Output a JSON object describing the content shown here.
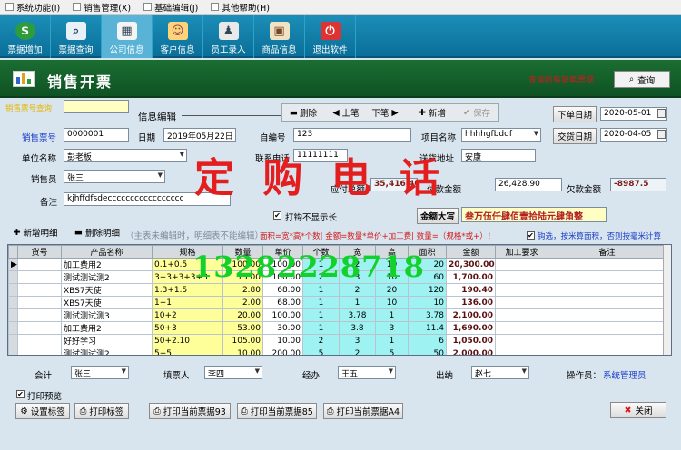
{
  "menubar": [
    "系统功能(I)",
    "销售管理(X)",
    "基础编辑(J)",
    "其他帮助(H)"
  ],
  "toolbar": [
    {
      "label": "票据增加",
      "icon": "dollar-icon"
    },
    {
      "label": "票据查询",
      "icon": "magnifier-icon"
    },
    {
      "label": "公司信息",
      "icon": "building-icon"
    },
    {
      "label": "客户信息",
      "icon": "customer-icon"
    },
    {
      "label": "员工录入",
      "icon": "employee-icon"
    },
    {
      "label": "商品信息",
      "icon": "product-icon"
    },
    {
      "label": "退出软件",
      "icon": "exit-icon"
    }
  ],
  "header": {
    "title": "销售开票",
    "hint": "查询所有销售票据",
    "query": "查询"
  },
  "form": {
    "search_label": "销售票号查询",
    "section": "信息编辑",
    "btn_delete": "删除",
    "btn_prev": "上笔",
    "btn_next": "下笔",
    "btn_new": "新增",
    "btn_save": "保存",
    "order_date_label": "下单日期",
    "order_date": "2020-05-01",
    "delivery_date_label": "交货日期",
    "delivery_date": "2020-04-05",
    "ticket_no_label": "销售票号",
    "ticket_no": "0000001",
    "date_label": "日期",
    "date": "2019年05月22日",
    "self_no_label": "自编号",
    "self_no": "123",
    "project_label": "项目名称",
    "project": "hhhhgfbddf",
    "unit_label": "单位名称",
    "unit": "彭老板",
    "phone_label": "联系电话",
    "phone": "11111111",
    "address_label": "送货地址",
    "address": "安康",
    "seller_label": "销售员",
    "seller": "张三",
    "receivable_label": "应付总额",
    "receivable": "35,416.40",
    "paid_label": "付款金额",
    "paid": "26,428.90",
    "owed_label": "欠款金额",
    "owed": "-8987.5",
    "remark_label": "备注",
    "remark": "kjhffdfsdeccccccccccccccccc",
    "hide_label": "打钩不显示长",
    "amount_upper_label": "金额大写",
    "amount_upper": "叁万伍仟肆佰壹拾陆元肆角整"
  },
  "detail": {
    "add": "新增明细",
    "del": "删除明细",
    "note": "（主表未编辑时，明细表不能编辑）",
    "formula": "面积=宽*高*个数|  金额=数量*单价+加工费|  数量=（规格*或+）！",
    "hint": "钩选，按米算面积，否则按毫米计算"
  },
  "watermark": {
    "text": "定 购 电 话",
    "number": "13282228718"
  },
  "grid": {
    "columns": [
      "货号",
      "产品名称",
      "规格",
      "数量",
      "单价",
      "个数",
      "宽",
      "高",
      "面积",
      "金额",
      "加工要求",
      "备注"
    ],
    "rows": [
      [
        "",
        "加工费用2",
        "0.1+0.5",
        "100.00",
        "100.00",
        "1",
        "2",
        "10",
        "20",
        "20,300.00",
        "",
        ""
      ],
      [
        "",
        "测试测试测2",
        "3+3+3+3+3",
        "15.00",
        "100.00",
        "2",
        "3",
        "10",
        "60",
        "1,700.00",
        "",
        ""
      ],
      [
        "",
        "XBS7天使",
        "1.3+1.5",
        "2.80",
        "68.00",
        "1",
        "2",
        "20",
        "120",
        "190.40",
        "",
        ""
      ],
      [
        "",
        "XBS7天使",
        "1+1",
        "2.00",
        "68.00",
        "1",
        "1",
        "10",
        "10",
        "136.00",
        "",
        ""
      ],
      [
        "",
        "测试测试测3",
        "10+2",
        "20.00",
        "100.00",
        "1",
        "3.78",
        "1",
        "3.78",
        "2,100.00",
        "",
        ""
      ],
      [
        "",
        "加工费用2",
        "50+3",
        "53.00",
        "30.00",
        "1",
        "3.8",
        "3",
        "11.4",
        "1,690.00",
        "",
        ""
      ],
      [
        "",
        "好好学习",
        "50+2.10",
        "105.00",
        "10.00",
        "2",
        "3",
        "1",
        "6",
        "1,050.00",
        "",
        ""
      ],
      [
        "",
        "测试测试测2",
        "5+5",
        "10.00",
        "200.00",
        "5",
        "2",
        "5",
        "50",
        "2,000.00",
        "",
        ""
      ]
    ]
  },
  "footer": {
    "acct_label": "会计",
    "acct": "张三",
    "filler_label": "填票人",
    "filler": "李四",
    "handler_label": "经办",
    "handler": "王五",
    "cashier_label": "出纳",
    "cashier": "赵七",
    "operator_label": "操作员：",
    "operator": "系统管理员",
    "preview": "打印预览",
    "set_label": "设置标签",
    "print_label": "打印标签",
    "print93": "打印当前票据93",
    "print85": "打印当前票据85",
    "printA4": "打印当前票据A4",
    "close": "关闭"
  }
}
